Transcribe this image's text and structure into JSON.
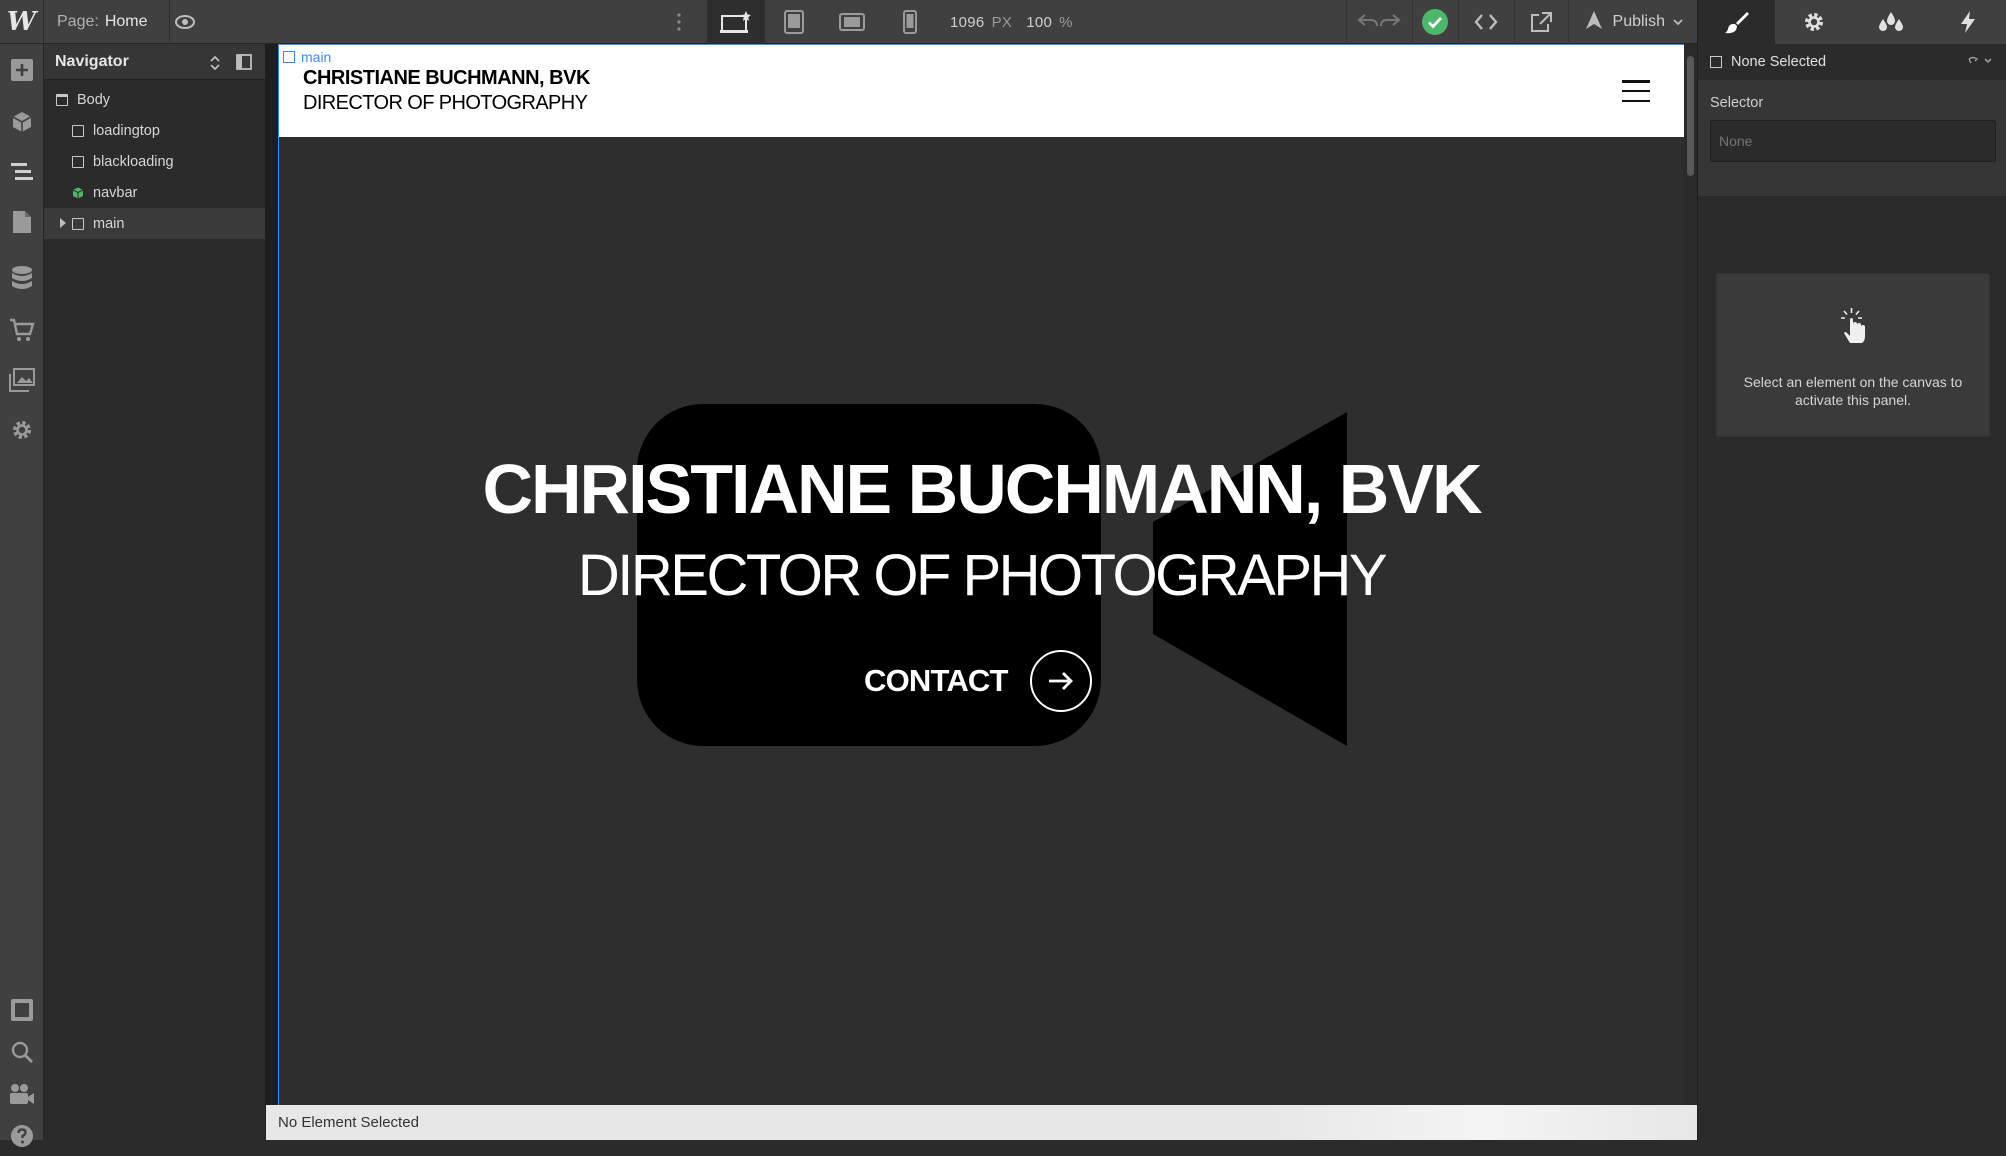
{
  "topbar": {
    "logo": "W",
    "page_label": "Page:",
    "page_name": "Home",
    "canvas_width": "1096",
    "canvas_width_unit": "PX",
    "zoom": "100",
    "zoom_unit": "%",
    "publish_label": "Publish"
  },
  "icons": {
    "preview": "eye-icon",
    "more": "vertical-dots-icon",
    "desktop": "desktop-star-icon",
    "tablet": "tablet-icon",
    "mobile_landscape": "mobile-landscape-icon",
    "mobile_portrait": "mobile-portrait-icon",
    "undo": "undo-icon",
    "redo": "redo-icon",
    "status": "check-circle-icon",
    "code": "code-icon",
    "export": "export-icon",
    "publish": "rocket-icon"
  },
  "navigator": {
    "title": "Navigator",
    "items": [
      {
        "label": "Body",
        "type": "body"
      },
      {
        "label": "loadingtop",
        "type": "element"
      },
      {
        "label": "blackloading",
        "type": "element"
      },
      {
        "label": "navbar",
        "type": "component"
      },
      {
        "label": "main",
        "type": "element",
        "collapsed": true
      }
    ]
  },
  "site": {
    "selected_tag": "main",
    "brand_name": "CHRISTIANE BUCHMANN, BVK",
    "brand_subtitle": "DIRECTOR OF PHOTOGRAPHY",
    "hero_title": "CHRISTIANE BUCHMANN, BVK",
    "hero_subtitle": "DIRECTOR OF PHOTOGRAPHY",
    "contact_label": "CONTACT"
  },
  "statusbar": {
    "text": "No Element Selected"
  },
  "right_panel": {
    "selection": "None Selected",
    "selector_label": "Selector",
    "selector_placeholder": "None",
    "hint": "Select an element on the canvas to activate this panel."
  },
  "colors": {
    "chrome": "#404040",
    "panel": "#2b2b2b",
    "accent": "#3d8af7",
    "success": "#4cb86b",
    "hero_bg": "#2e2e2e"
  }
}
